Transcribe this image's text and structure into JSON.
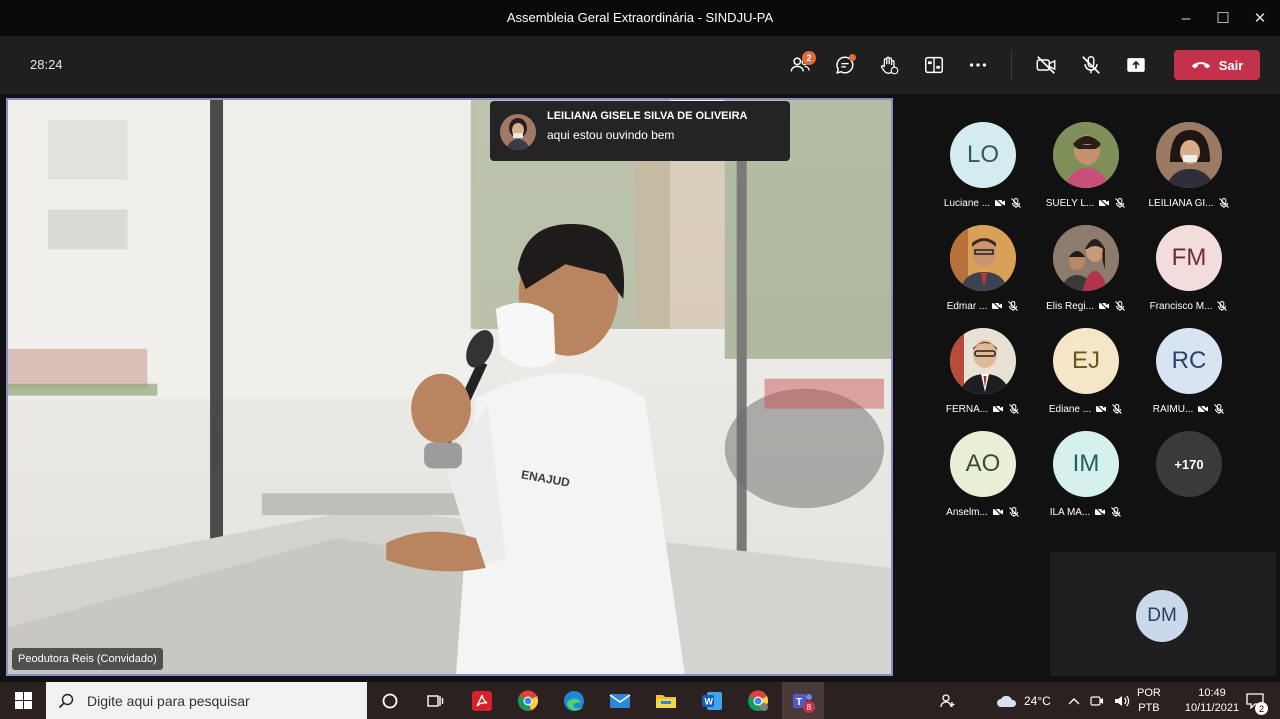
{
  "window": {
    "title": "Assembleia Geral Extraordinária - SINDJU-PA",
    "minimize": "–",
    "maximize": "☐",
    "close": "✕"
  },
  "toolbar": {
    "timer": "28:24",
    "participants_badge": "2",
    "leave_label": "Sair",
    "icons": [
      "people-icon",
      "chat-icon",
      "raise-hand-icon",
      "rooms-icon",
      "more-icon",
      "camera-off-icon",
      "mic-off-icon",
      "share-icon",
      "phone-icon"
    ]
  },
  "main_video": {
    "speaker_name": "Peodutora Reis (Convidado)"
  },
  "chat_toast": {
    "sender": "LEILIANA GISELE SILVA DE OLIVEIRA",
    "message": "aqui estou ouvindo bem"
  },
  "participants": [
    {
      "initials": "LO",
      "name": "Luciane ...",
      "color": "#d4ecef",
      "text_color": "#2c5a60",
      "photo": false
    },
    {
      "initials": "",
      "name": "SUELY L...",
      "color": "#7a6a4a",
      "photo": true
    },
    {
      "initials": "",
      "name": "LEILIANA GI...",
      "color": "#8a6e5c",
      "photo": true
    },
    {
      "initials": "",
      "name": "Edmar ...",
      "color": "#8a5b3a",
      "photo": true
    },
    {
      "initials": "",
      "name": "Elis Regi...",
      "color": "#9b6b5a",
      "photo": true
    },
    {
      "initials": "FM",
      "name": "Francisco M...",
      "color": "#f2dcdc",
      "text_color": "#6a2e34",
      "photo": false
    },
    {
      "initials": "",
      "name": "FERNA...",
      "color": "#8a4d3e",
      "photo": true
    },
    {
      "initials": "EJ",
      "name": "Ediane ...",
      "color": "#f6e6c8",
      "text_color": "#6e5420",
      "photo": false
    },
    {
      "initials": "RC",
      "name": "RAIMU...",
      "color": "#d8e4f2",
      "text_color": "#27446b",
      "photo": false
    },
    {
      "initials": "AO",
      "name": "Anselm...",
      "color": "#e8efd6",
      "text_color": "#3e4e22",
      "photo": false
    },
    {
      "initials": "IM",
      "name": "ILA MA...",
      "color": "#d6f0ee",
      "text_color": "#245e58",
      "photo": false
    },
    {
      "initials": "+170",
      "name": "",
      "color": "#3a3a3a",
      "photo": false
    }
  ],
  "self_view": {
    "initials": "DM"
  },
  "taskbar": {
    "search_placeholder": "Digite aqui para pesquisar",
    "temperature": "24°C",
    "lang_top": "POR",
    "lang_bottom": "PTB",
    "time": "10:49",
    "date": "10/11/2021",
    "teams_badge": "8",
    "notif_count": "2",
    "apps": [
      "cortana-icon",
      "task-view-icon",
      "acrobat-icon",
      "chrome-icon",
      "edge-icon",
      "mail-icon",
      "file-explorer-icon",
      "word-icon",
      "chrome-profile-icon",
      "teams-icon"
    ]
  }
}
